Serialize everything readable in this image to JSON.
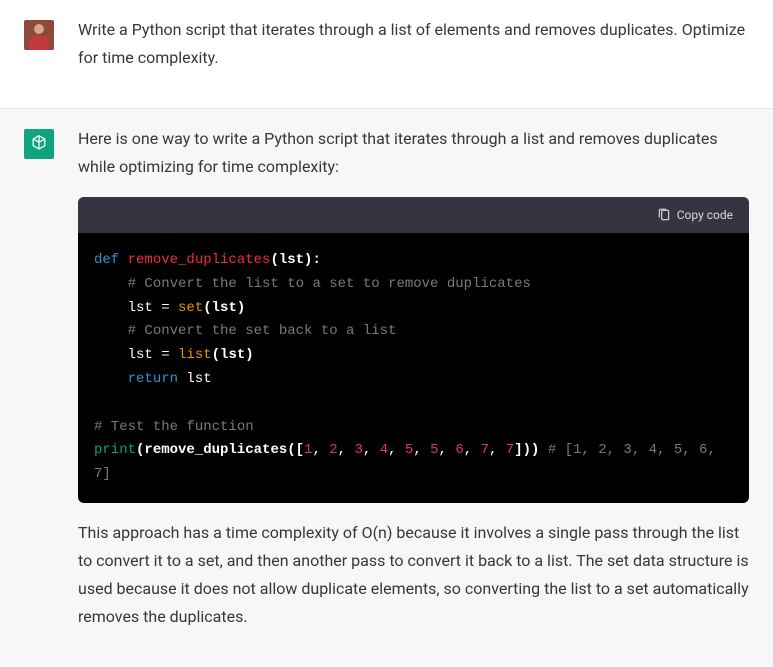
{
  "user_message": {
    "text": "Write a Python script that iterates through a list of elements and removes duplicates. Optimize for time complexity."
  },
  "assistant_message": {
    "intro": "Here is one way to write a Python script that iterates through a list and removes duplicates while optimizing for time complexity:",
    "code": {
      "copy_label": "Copy code",
      "tokens": [
        [
          [
            "def ",
            "tok-keyword"
          ],
          [
            "remove_duplicates",
            "tok-funcname"
          ],
          [
            "(lst):",
            "tok-paren"
          ]
        ],
        [
          [
            "    ",
            ""
          ],
          [
            "# Convert the list to a set to remove duplicates",
            "tok-comment"
          ]
        ],
        [
          [
            "    lst = ",
            "tok-ident"
          ],
          [
            "set",
            "tok-builtin"
          ],
          [
            "(lst)",
            "tok-paren"
          ]
        ],
        [
          [
            "    ",
            ""
          ],
          [
            "# Convert the set back to a list",
            "tok-comment"
          ]
        ],
        [
          [
            "    lst = ",
            "tok-ident"
          ],
          [
            "list",
            "tok-builtin"
          ],
          [
            "(lst)",
            "tok-paren"
          ]
        ],
        [
          [
            "    ",
            ""
          ],
          [
            "return",
            "tok-keyword"
          ],
          [
            " lst",
            "tok-ident"
          ]
        ],
        [],
        [
          [
            "# Test the function",
            "tok-comment"
          ]
        ],
        [
          [
            "print",
            "tok-print"
          ],
          [
            "(remove_duplicates([",
            "tok-paren"
          ],
          [
            "1",
            "tok-number"
          ],
          [
            ", ",
            "tok-ident"
          ],
          [
            "2",
            "tok-number"
          ],
          [
            ", ",
            "tok-ident"
          ],
          [
            "3",
            "tok-number"
          ],
          [
            ", ",
            "tok-ident"
          ],
          [
            "4",
            "tok-number"
          ],
          [
            ", ",
            "tok-ident"
          ],
          [
            "5",
            "tok-number"
          ],
          [
            ", ",
            "tok-ident"
          ],
          [
            "5",
            "tok-number"
          ],
          [
            ", ",
            "tok-ident"
          ],
          [
            "6",
            "tok-number"
          ],
          [
            ", ",
            "tok-ident"
          ],
          [
            "7",
            "tok-number"
          ],
          [
            ", ",
            "tok-ident"
          ],
          [
            "7",
            "tok-number"
          ],
          [
            "])) ",
            "tok-paren"
          ],
          [
            "# [1, 2, 3, 4, 5, 6, 7]",
            "tok-comment"
          ]
        ]
      ]
    },
    "outro": "This approach has a time complexity of O(n) because it involves a single pass through the list to convert it to a set, and then another pass to convert it back to a list. The set data structure is used because it does not allow duplicate elements, so converting the list to a set automatically removes the duplicates."
  }
}
